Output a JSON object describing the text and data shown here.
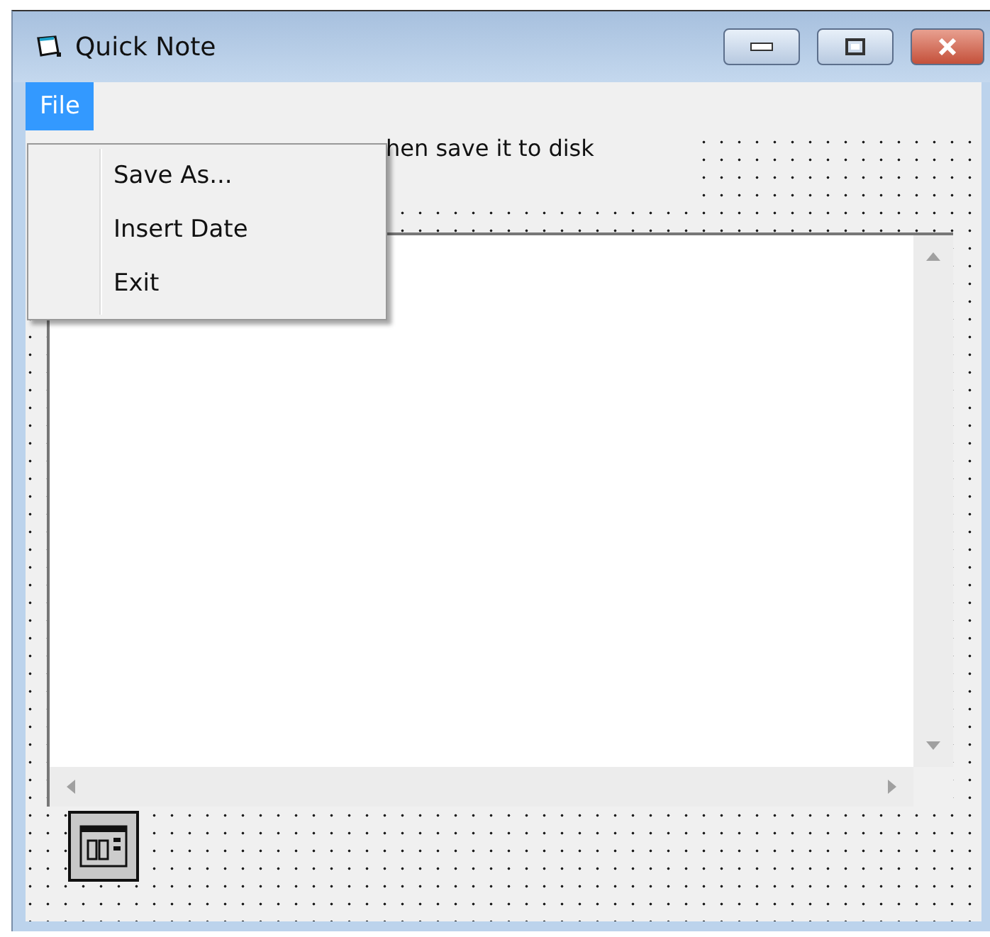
{
  "window": {
    "title": "Quick Note"
  },
  "menu_bar": [
    {
      "label": "File",
      "selected": true
    }
  ],
  "open_menu": {
    "items": [
      {
        "label": "Save As..."
      },
      {
        "label": "Insert Date"
      },
      {
        "label": "Exit"
      }
    ]
  },
  "form": {
    "label": "hen save it to disk"
  }
}
